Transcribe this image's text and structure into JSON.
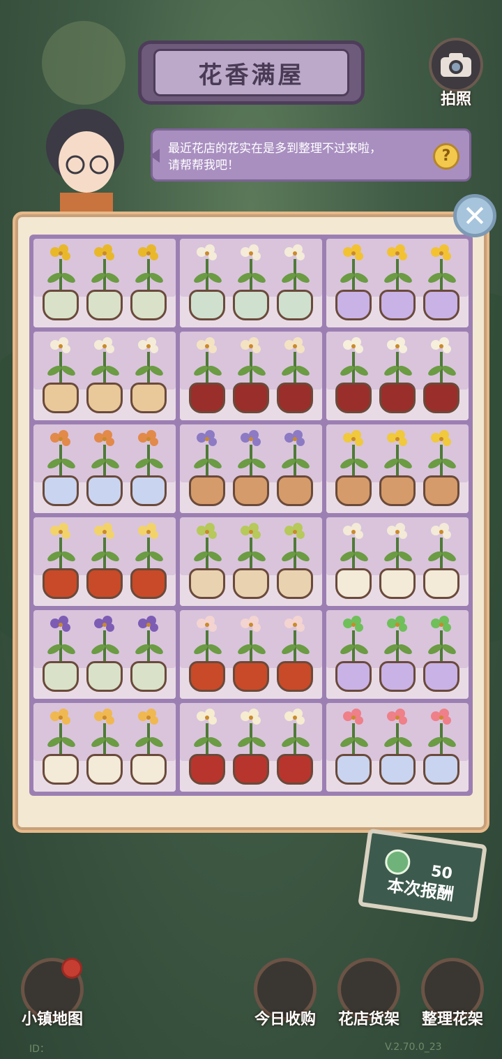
{
  "header": {
    "title": "花香满屋",
    "camera_label": "拍照"
  },
  "dialog": {
    "text_line1": "最近花店的花实在是多到整理不过来啦，",
    "text_line2": "请帮帮我吧！",
    "help_symbol": "?"
  },
  "close_symbol": "✕",
  "shelf": [
    {
      "flower": "#e8b82a",
      "vase": "#d9e2c9"
    },
    {
      "flower": "#f4ecd8",
      "vase": "#cfe0cf"
    },
    {
      "flower": "#f2c233",
      "vase": "#c9b2e6"
    },
    {
      "flower": "#f4ecd8",
      "vase": "#e9c89a"
    },
    {
      "flower": "#f3e3c3",
      "vase": "#9a2e2a"
    },
    {
      "flower": "#f6efdc",
      "vase": "#9a2e2a"
    },
    {
      "flower": "#e28a4a",
      "vase": "#c9d4f0"
    },
    {
      "flower": "#8c7ac4",
      "vase": "#d69b6a"
    },
    {
      "flower": "#f0c93c",
      "vase": "#d69b6a"
    },
    {
      "flower": "#f2d36a",
      "vase": "#c94a28"
    },
    {
      "flower": "#b6c95a",
      "vase": "#e9d2b0"
    },
    {
      "flower": "#f3ead8",
      "vase": "#f3ead8"
    },
    {
      "flower": "#7d5cb4",
      "vase": "#d9e2c9"
    },
    {
      "flower": "#f3d4d0",
      "vase": "#c94a28"
    },
    {
      "flower": "#6fbf5a",
      "vase": "#c9b2e6"
    },
    {
      "flower": "#f0b850",
      "vase": "#f3ead8"
    },
    {
      "flower": "#f6ecd0",
      "vase": "#b8352e"
    },
    {
      "flower": "#ef7f88",
      "vase": "#c9d4f0"
    }
  ],
  "reward": {
    "value": "50",
    "label": "本次报酬"
  },
  "nav": {
    "map": "小镇地图",
    "today": "今日收购",
    "shop_shelf": "花店货架",
    "arrange": "整理花架"
  },
  "footer": {
    "id_prefix": "ID：",
    "version": "V.2.70.0_23"
  },
  "colors": {
    "panel_bg": "#f3e8d2",
    "grid_border": "#9c7fb2",
    "bubble": "#a98fc0"
  }
}
